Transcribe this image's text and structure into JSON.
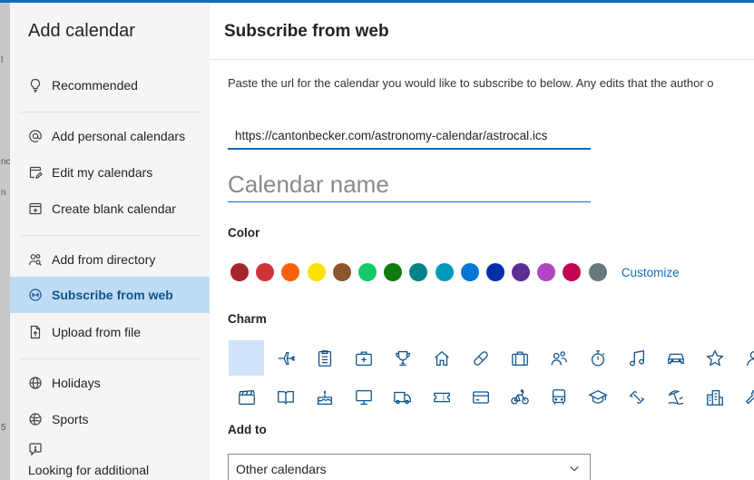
{
  "backdrop": {
    "fragments": [
      "l",
      "nc",
      "n",
      "5"
    ]
  },
  "sidebar": {
    "title": "Add calendar",
    "items": [
      {
        "key": "recommended",
        "label": "Recommended",
        "icon": "lightbulb-icon"
      },
      {
        "key": "add-personal",
        "label": "Add personal calendars",
        "icon": "at-icon"
      },
      {
        "key": "edit-my",
        "label": "Edit my calendars",
        "icon": "calendar-edit-icon"
      },
      {
        "key": "create-blank",
        "label": "Create blank calendar",
        "icon": "calendar-add-icon"
      },
      {
        "key": "add-directory",
        "label": "Add from directory",
        "icon": "people-search-icon"
      },
      {
        "key": "subscribe-web",
        "label": "Subscribe from web",
        "icon": "globe-link-icon",
        "active": true
      },
      {
        "key": "upload-file",
        "label": "Upload from file",
        "icon": "document-icon"
      },
      {
        "key": "holidays",
        "label": "Holidays",
        "icon": "globe-icon"
      },
      {
        "key": "sports",
        "label": "Sports",
        "icon": "sports-ball-icon"
      }
    ],
    "footer_label": "Looking for additional"
  },
  "main": {
    "title": "Subscribe from web",
    "instructions": "Paste the url for the calendar you would like to subscribe to below. Any edits that the author o",
    "url_value": "https://cantonbecker.com/astronomy-calendar/astrocal.ics",
    "name_placeholder": "Calendar name",
    "color_label": "Color",
    "colors": [
      "#a4262c",
      "#d13438",
      "#f7630c",
      "#fce100",
      "#8e562e",
      "#13c96a",
      "#107c10",
      "#038387",
      "#0099bc",
      "#0078d4",
      "#0030a8",
      "#5c2e91",
      "#b146c2",
      "#c30052",
      "#69797e"
    ],
    "customize_label": "Customize",
    "charm_label": "Charm",
    "charms": [
      [
        "none",
        "airplane",
        "clipboard",
        "medical-bag",
        "trophy",
        "home",
        "pill",
        "briefcase",
        "people",
        "stopwatch",
        "music-note",
        "car",
        "star",
        "person"
      ],
      [
        "clapperboard",
        "book",
        "cake",
        "monitor",
        "truck",
        "ticket",
        "credit-card",
        "bicycle",
        "bus",
        "graduation-cap",
        "dumbbell",
        "beach",
        "city",
        "wrench"
      ]
    ],
    "add_to_label": "Add to",
    "add_to_value": "Other calendars"
  },
  "colors": {
    "accent": "#0f6cbd",
    "active_bg": "#bfdcf7",
    "sidebar_bg": "#f5f5f5"
  }
}
